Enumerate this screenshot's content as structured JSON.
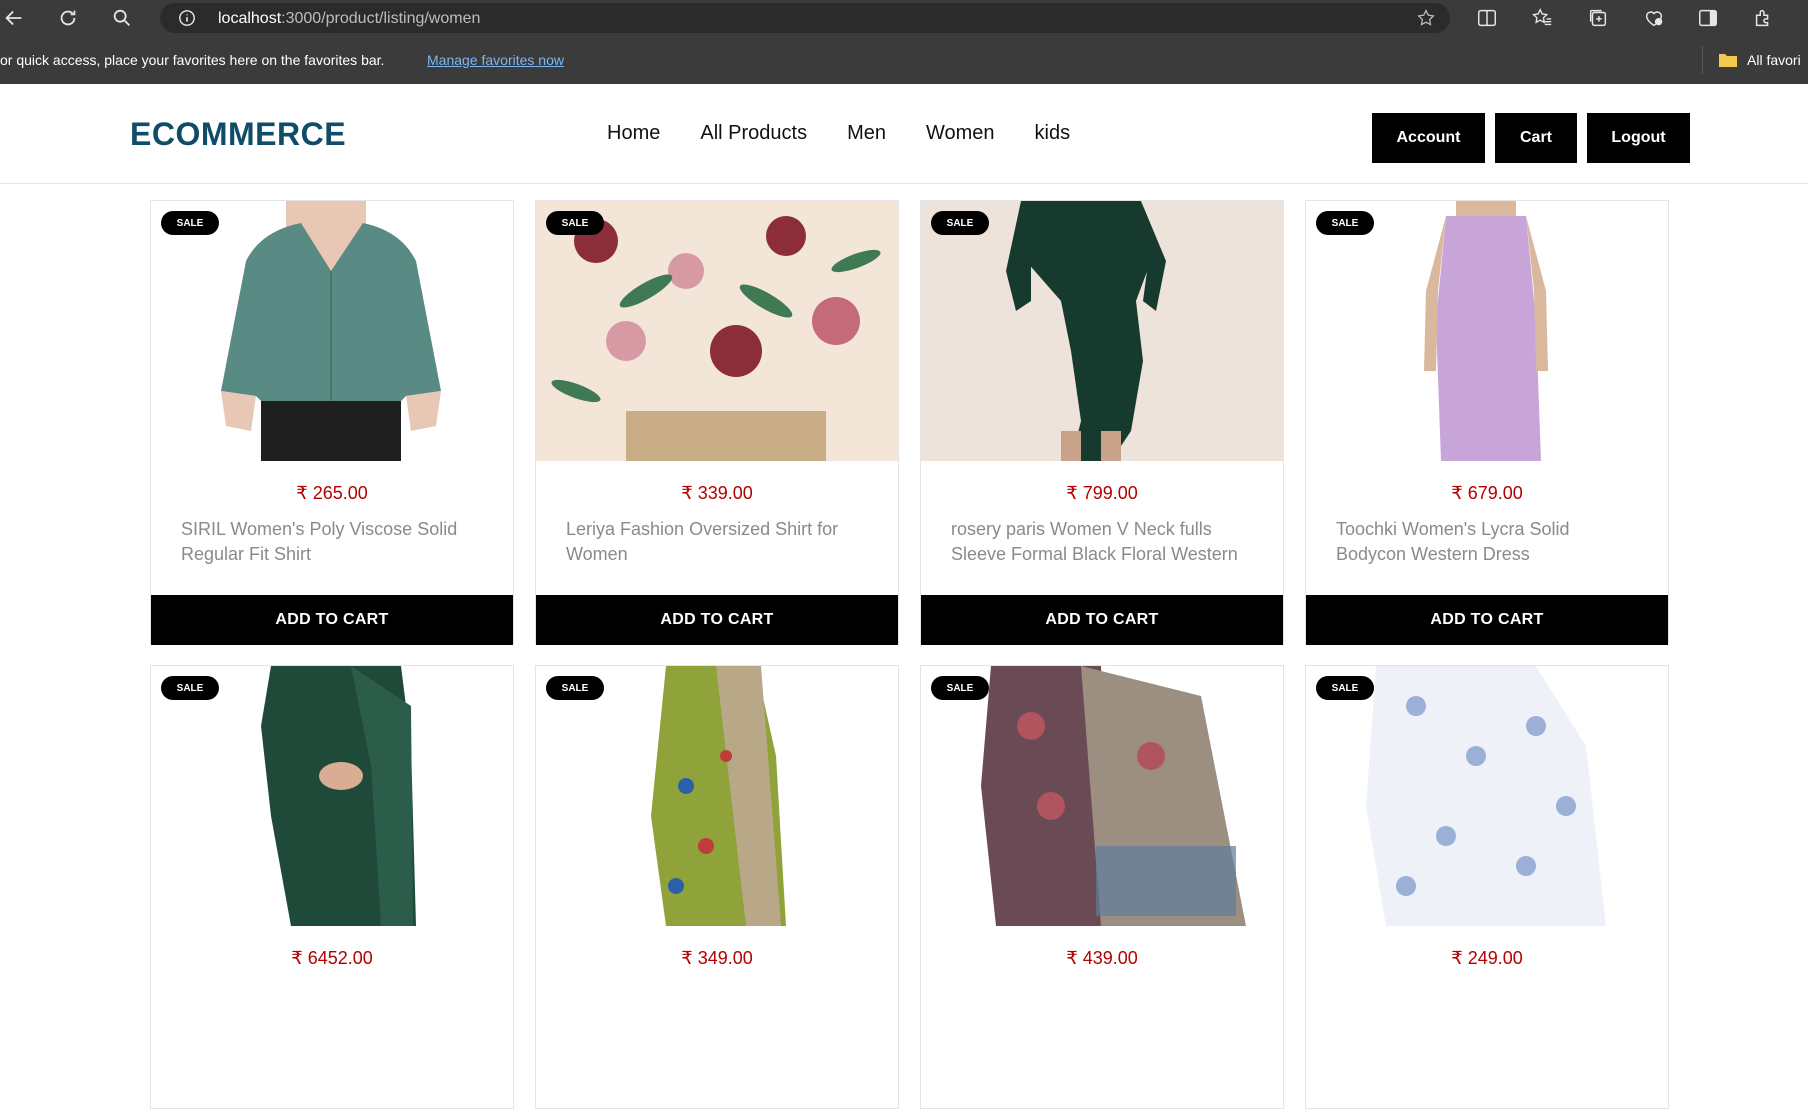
{
  "browser": {
    "url_host": "localhost",
    "url_rest": ":3000/product/listing/women",
    "favorites_text": "or quick access, place your favorites here on the favorites bar.",
    "favorites_link": "Manage favorites now",
    "all_favorites": "All favori"
  },
  "header": {
    "brand": "ECOMMERCE",
    "nav": [
      "Home",
      "All Products",
      "Men",
      "Women",
      "kids"
    ],
    "account": "Account",
    "cart": "Cart",
    "logout": "Logout"
  },
  "products": [
    {
      "badge": "SALE",
      "price": "₹ 265.00",
      "title": "SIRIL Women's Poly Viscose Solid Regular Fit Shirt",
      "button": "ADD TO CART"
    },
    {
      "badge": "SALE",
      "price": "₹ 339.00",
      "title": "Leriya Fashion Oversized Shirt for Women",
      "button": "ADD TO CART"
    },
    {
      "badge": "SALE",
      "price": "₹ 799.00",
      "title": "rosery paris Women V Neck fulls Sleeve Formal Black Floral Western",
      "button": "ADD TO CART"
    },
    {
      "badge": "SALE",
      "price": "₹ 679.00",
      "title": "Toochki Women's Lycra Solid Bodycon Western Dress",
      "button": "ADD TO CART"
    },
    {
      "badge": "SALE",
      "price": "₹ 6452.00",
      "title": "",
      "button": ""
    },
    {
      "badge": "SALE",
      "price": "₹ 349.00",
      "title": "",
      "button": ""
    },
    {
      "badge": "SALE",
      "price": "₹ 439.00",
      "title": "",
      "button": ""
    },
    {
      "badge": "SALE",
      "price": "₹ 249.00",
      "title": "",
      "button": ""
    }
  ],
  "colors": {
    "brand": "#0f4c68",
    "price": "#b30000",
    "button_bg": "#000000",
    "chrome_bg": "#3b3b3b"
  },
  "icons": [
    "back-icon",
    "refresh-icon",
    "search-icon",
    "info-icon",
    "star-icon",
    "split-screen-icon",
    "favorites-icon",
    "collections-icon",
    "browser-essentials-icon",
    "sidebar-icon",
    "extensions-icon",
    "folder-icon"
  ]
}
